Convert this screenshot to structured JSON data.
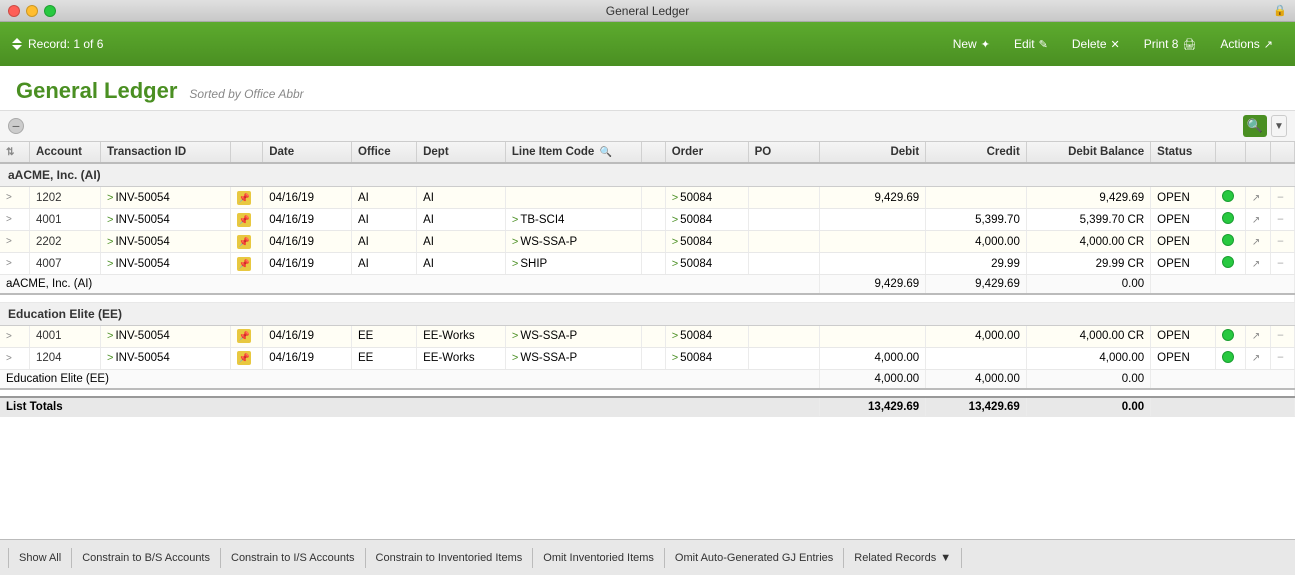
{
  "titleBar": {
    "title": "General Ledger",
    "trafficLights": [
      "close",
      "minimize",
      "maximize"
    ]
  },
  "toolbar": {
    "record": "Record: 1 of 6",
    "newLabel": "New",
    "editLabel": "Edit",
    "deleteLabel": "Delete",
    "printLabel": "Print 8",
    "actionsLabel": "Actions"
  },
  "pageHeader": {
    "title": "General Ledger",
    "subtitle": "Sorted by Office Abbr"
  },
  "table": {
    "columns": [
      "",
      "Account",
      "Transaction ID",
      "",
      "Date",
      "Office",
      "Dept",
      "Line Item Code",
      "",
      "Order",
      "PO",
      "Debit",
      "Credit",
      "Debit Balance",
      "Status",
      "",
      "",
      ""
    ],
    "groups": [
      {
        "name": "aACME, Inc. (AI)",
        "rows": [
          {
            "nav": ">",
            "account": "1202",
            "transNav": ">",
            "transId": "INV-50054",
            "pin": true,
            "date": "04/16/19",
            "office": "AI",
            "dept": "AI",
            "lineItemNav": "",
            "lineItem": "",
            "orderNav": ">",
            "order": "50084",
            "po": "",
            "debit": "9,429.69",
            "credit": "",
            "balance": "9,429.69",
            "status": "OPEN",
            "dot": true,
            "ext": true,
            "dash": true
          },
          {
            "nav": ">",
            "account": "4001",
            "transNav": ">",
            "transId": "INV-50054",
            "pin": true,
            "date": "04/16/19",
            "office": "AI",
            "dept": "AI",
            "lineItemNav": ">",
            "lineItem": "TB-SCI4",
            "orderNav": ">",
            "order": "50084",
            "po": "",
            "debit": "",
            "credit": "5,399.70",
            "balance": "5,399.70 CR",
            "status": "OPEN",
            "dot": true,
            "ext": true,
            "dash": true
          },
          {
            "nav": ">",
            "account": "2202",
            "transNav": ">",
            "transId": "INV-50054",
            "pin": true,
            "date": "04/16/19",
            "office": "AI",
            "dept": "AI",
            "lineItemNav": ">",
            "lineItem": "WS-SSA-P",
            "orderNav": ">",
            "order": "50084",
            "po": "",
            "debit": "",
            "credit": "4,000.00",
            "balance": "4,000.00 CR",
            "status": "OPEN",
            "dot": true,
            "ext": true,
            "dash": true
          },
          {
            "nav": ">",
            "account": "4007",
            "transNav": ">",
            "transId": "INV-50054",
            "pin": true,
            "date": "04/16/19",
            "office": "AI",
            "dept": "AI",
            "lineItemNav": ">",
            "lineItem": "SHIP",
            "orderNav": ">",
            "order": "50084",
            "po": "",
            "debit": "",
            "credit": "29.99",
            "balance": "29.99 CR",
            "status": "OPEN",
            "dot": true,
            "ext": true,
            "dash": true
          }
        ],
        "total": {
          "label": "aACME, Inc. (AI)",
          "debit": "9,429.69",
          "credit": "9,429.69",
          "balance": "0.00"
        }
      },
      {
        "name": "Education Elite (EE)",
        "rows": [
          {
            "nav": ">",
            "account": "4001",
            "transNav": ">",
            "transId": "INV-50054",
            "pin": true,
            "date": "04/16/19",
            "office": "EE",
            "dept": "EE-Works",
            "lineItemNav": ">",
            "lineItem": "WS-SSA-P",
            "orderNav": ">",
            "order": "50084",
            "po": "",
            "debit": "",
            "credit": "4,000.00",
            "balance": "4,000.00 CR",
            "status": "OPEN",
            "dot": true,
            "ext": true,
            "dash": true
          },
          {
            "nav": ">",
            "account": "1204",
            "transNav": ">",
            "transId": "INV-50054",
            "pin": true,
            "date": "04/16/19",
            "office": "EE",
            "dept": "EE-Works",
            "lineItemNav": ">",
            "lineItem": "WS-SSA-P",
            "orderNav": ">",
            "order": "50084",
            "po": "",
            "debit": "4,000.00",
            "credit": "",
            "balance": "4,000.00",
            "status": "OPEN",
            "dot": true,
            "ext": true,
            "dash": true
          }
        ],
        "total": {
          "label": "Education Elite (EE)",
          "debit": "4,000.00",
          "credit": "4,000.00",
          "balance": "0.00"
        }
      }
    ],
    "listTotals": {
      "label": "List Totals",
      "debit": "13,429.69",
      "credit": "13,429.69",
      "balance": "0.00"
    }
  },
  "bottomBar": {
    "buttons": [
      {
        "label": "Show All",
        "active": false
      },
      {
        "label": "Constrain to B/S Accounts",
        "active": false
      },
      {
        "label": "Constrain to I/S Accounts",
        "active": false
      },
      {
        "label": "Constrain to Inventoried Items",
        "active": false
      },
      {
        "label": "Omit Inventoried Items",
        "active": false
      },
      {
        "label": "Omit Auto-Generated GJ Entries",
        "active": false
      },
      {
        "label": "Related Records",
        "active": false,
        "hasArrow": true
      }
    ]
  }
}
